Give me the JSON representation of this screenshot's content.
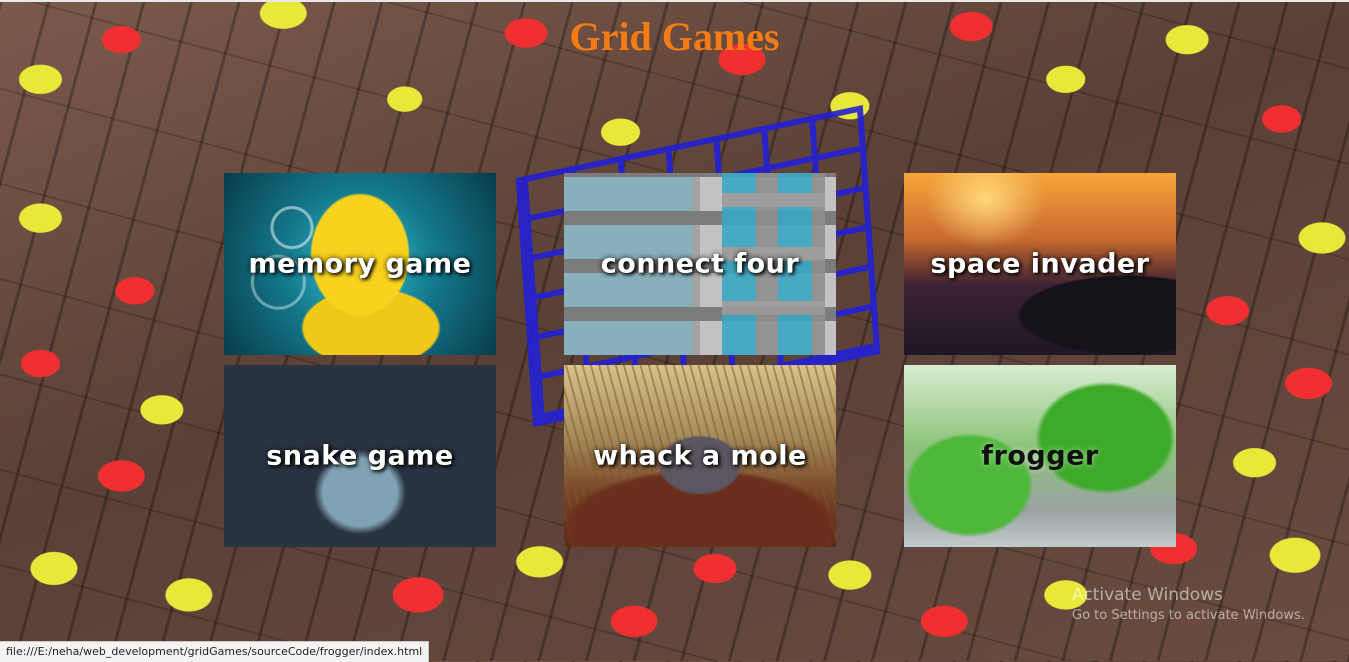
{
  "page": {
    "title": "Grid Games",
    "title_color": "#f57c14"
  },
  "games": [
    {
      "label": "memory game",
      "art": "pikachu-image"
    },
    {
      "label": "connect four",
      "art": "building-windows-image"
    },
    {
      "label": "space invader",
      "art": "sunset-car-image"
    },
    {
      "label": "snake game",
      "art": "snake-image"
    },
    {
      "label": "whack a mole",
      "art": "mole-image"
    },
    {
      "label": "frogger",
      "art": "frogs-image"
    }
  ],
  "watermark": {
    "title": "Activate Windows",
    "subtitle": "Go to Settings to activate Windows."
  },
  "status_bar": {
    "url": "file:///E:/neha/web_development/gridGames/sourceCode/frogger/index.html"
  },
  "colors": {
    "coin_red": "#f03030",
    "coin_yellow": "#e8e83a",
    "board_blue": "#2320d6"
  }
}
